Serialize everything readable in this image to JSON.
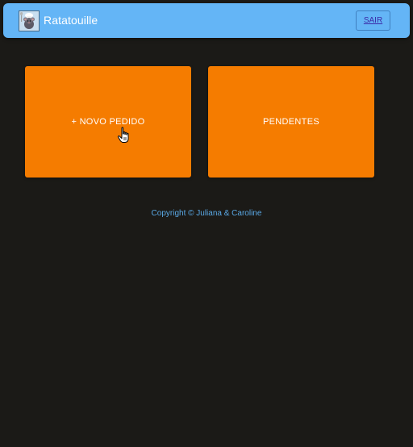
{
  "app": {
    "title": "Ratatouille",
    "logout_label": "SAIR"
  },
  "cards": {
    "new_order_label": "+ NOVO PEDIDO",
    "pending_label": "PENDENTES"
  },
  "footer": {
    "copyright": "Copyright © Juliana & Caroline"
  },
  "colors": {
    "background": "#1b1a17",
    "appbar": "#64b5f6",
    "card": "#f57c00",
    "footer_text": "#5aa9e6"
  },
  "icons": {
    "logo": "rat-chef-logo-icon",
    "cursor": "hand-pointer-icon"
  }
}
